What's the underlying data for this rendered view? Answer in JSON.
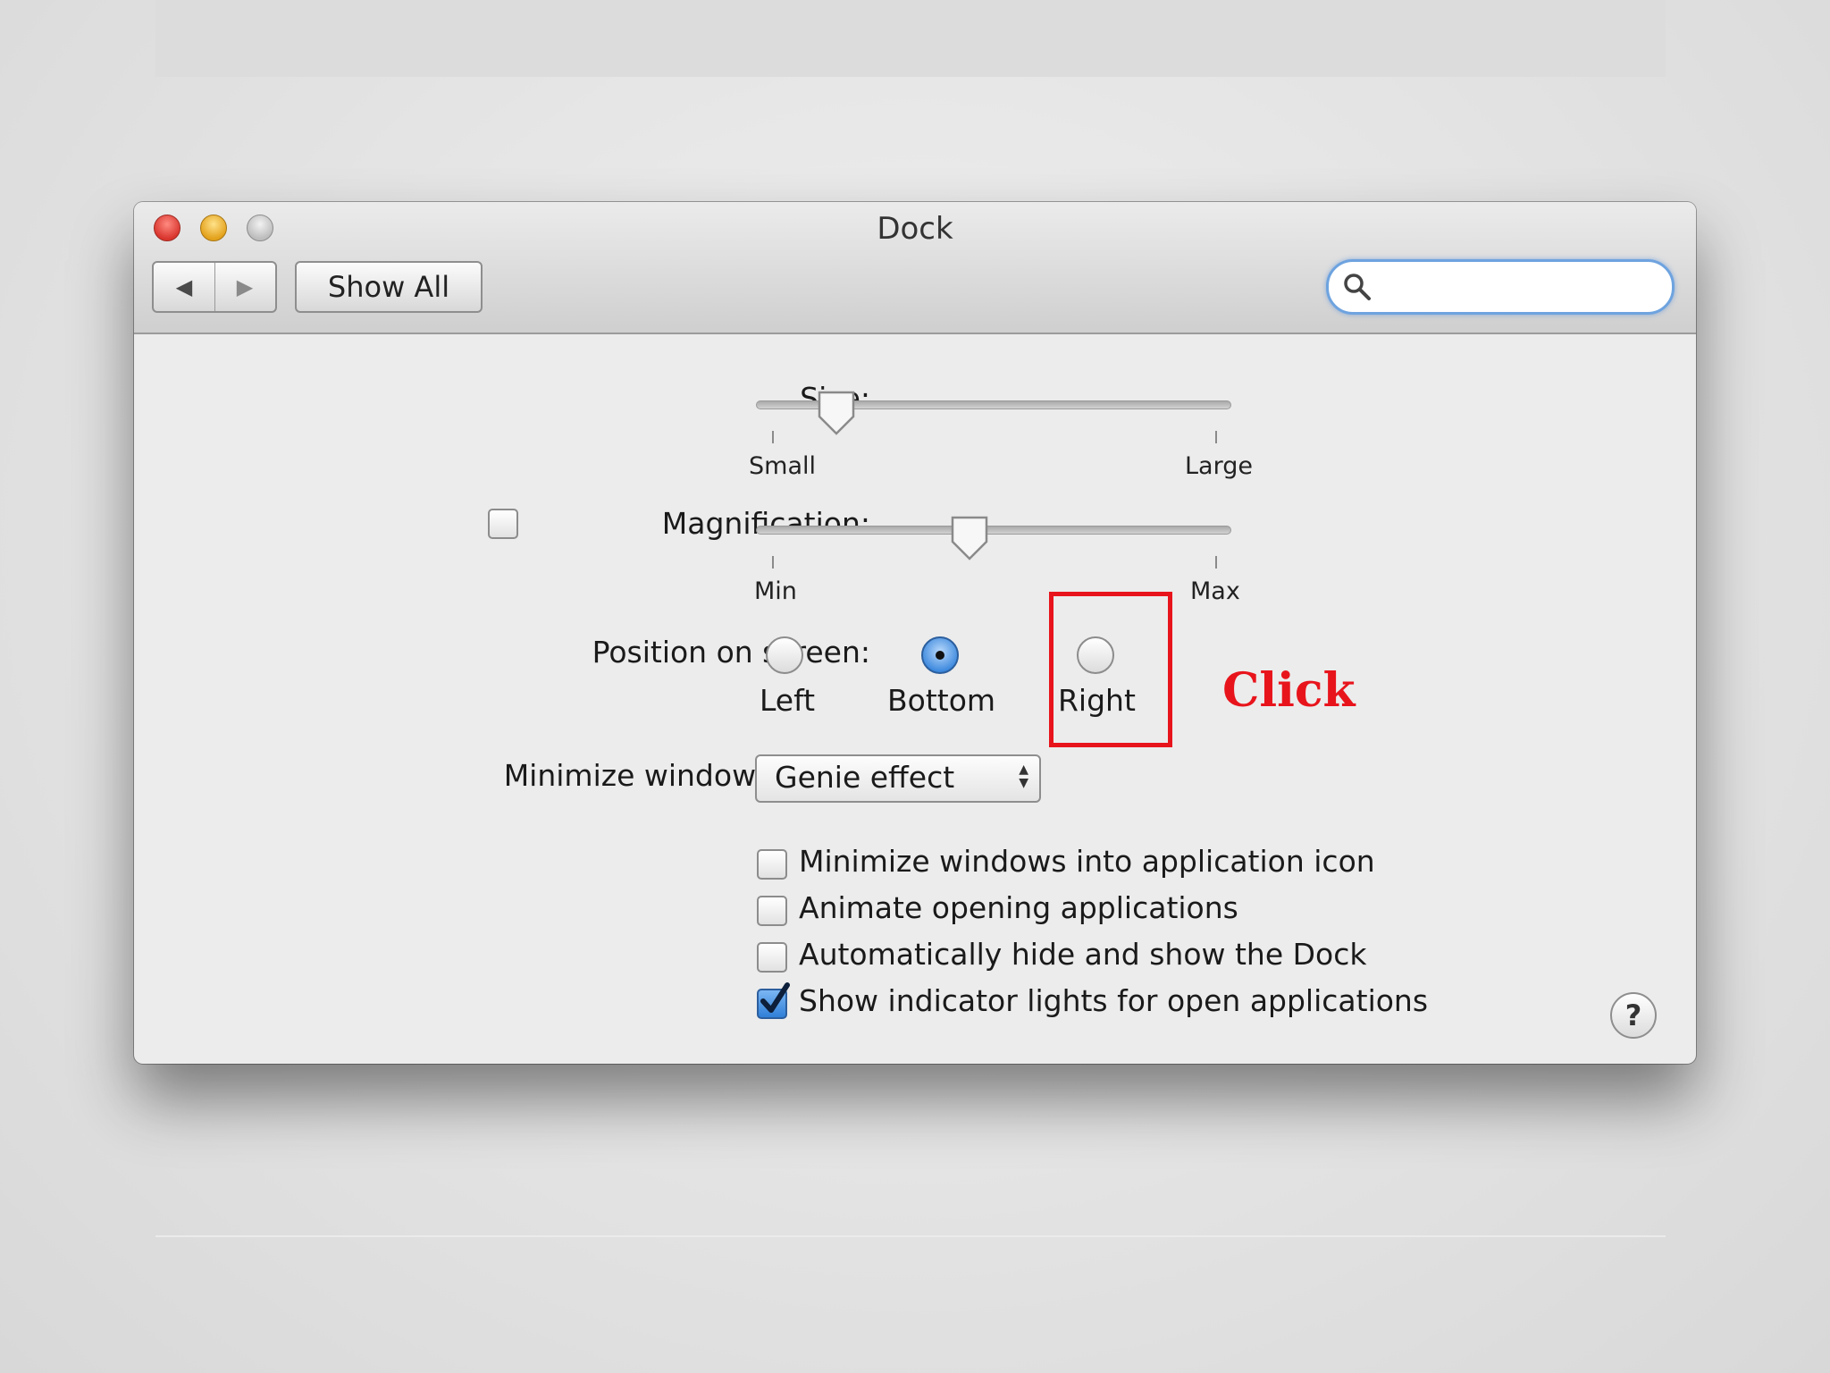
{
  "window": {
    "title": "Dock"
  },
  "toolbar": {
    "show_all": "Show All",
    "back_icon": "◀",
    "forward_icon": "▶",
    "search_placeholder": ""
  },
  "settings": {
    "size_label": "Size:",
    "size_min": "Small",
    "size_max": "Large",
    "size_value": 0.17,
    "magnification_label": "Magnification:",
    "magnification_enabled": false,
    "magnification_min": "Min",
    "magnification_max": "Max",
    "magnification_value": 0.45,
    "position_label": "Position on screen:",
    "position_options": [
      "Left",
      "Bottom",
      "Right"
    ],
    "position_selected": "Bottom",
    "minimize_label": "Minimize windows using:",
    "minimize_value": "Genie effect",
    "checkboxes": [
      {
        "label": "Minimize windows into application icon",
        "checked": false
      },
      {
        "label": "Animate opening applications",
        "checked": false
      },
      {
        "label": "Automatically hide and show the Dock",
        "checked": false
      },
      {
        "label": "Show indicator lights for open applications",
        "checked": true
      }
    ],
    "help_label": "?"
  },
  "annotation": {
    "text": "Click",
    "color": "#e8141c"
  }
}
